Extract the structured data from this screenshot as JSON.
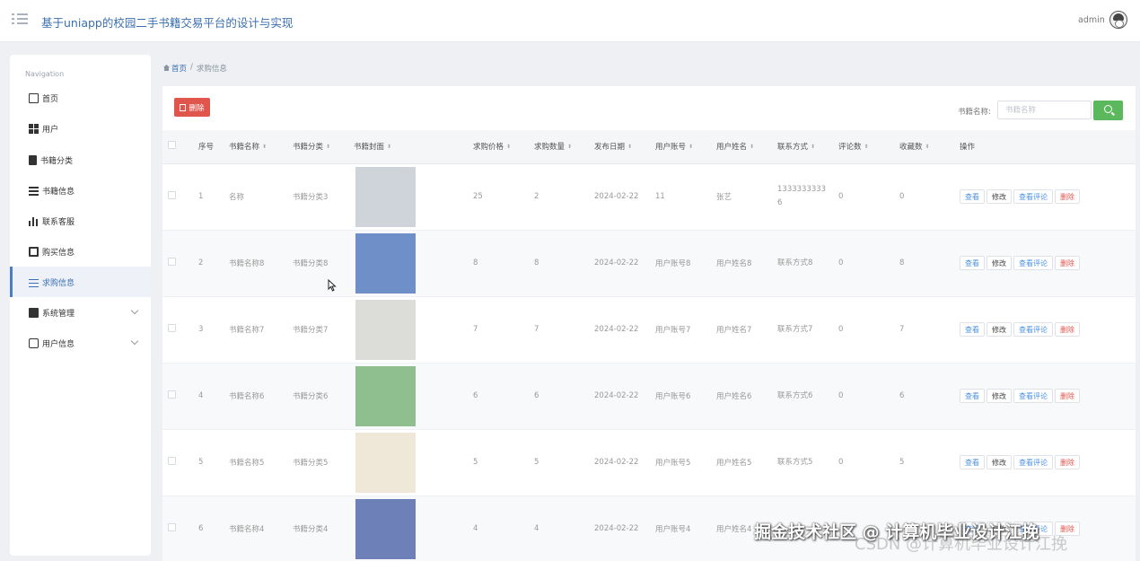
{
  "header": {
    "title": "基于uniapp的校园二手书籍交易平台的设计与实现",
    "user": "admin"
  },
  "sidebar": {
    "heading": "Navigation",
    "items": [
      {
        "label": "首页",
        "icon": "home-icon"
      },
      {
        "label": "用户",
        "icon": "grid-icon"
      },
      {
        "label": "书籍分类",
        "icon": "book-icon"
      },
      {
        "label": "书籍信息",
        "icon": "list-icon"
      },
      {
        "label": "联系客服",
        "icon": "bar-chart-icon"
      },
      {
        "label": "购买信息",
        "icon": "cart-icon"
      },
      {
        "label": "求购信息",
        "icon": "sliders-icon",
        "active": true
      },
      {
        "label": "系统管理",
        "icon": "chart-icon",
        "expandable": true
      },
      {
        "label": "用户信息",
        "icon": "card-icon",
        "expandable": true
      }
    ]
  },
  "breadcrumb": {
    "home": "首页",
    "separator": "/",
    "current": "求购信息"
  },
  "toolbar": {
    "delete_label": "删除",
    "search_label": "书籍名称:",
    "search_placeholder": "书籍名称"
  },
  "table": {
    "headers": [
      "序号",
      "书籍名称",
      "书籍分类",
      "书籍封面",
      "求购价格",
      "求购数量",
      "发布日期",
      "用户账号",
      "用户姓名",
      "联系方式",
      "评论数",
      "收藏数",
      "操作"
    ],
    "actions": {
      "view": "查看",
      "edit": "修改",
      "comments": "查看评论",
      "delete": "删除"
    },
    "rows": [
      {
        "no": "1",
        "name": "名称",
        "category": "书籍分类3",
        "price": "25",
        "qty": "2",
        "date": "2024-02-22",
        "account": "11",
        "username": "张艺",
        "contact": "13333333336",
        "comments": "0",
        "favorites": "0",
        "cover": "#cfd3da"
      },
      {
        "no": "2",
        "name": "书籍名称8",
        "category": "书籍分类8",
        "price": "8",
        "qty": "8",
        "date": "2024-02-22",
        "account": "用户账号8",
        "username": "用户姓名8",
        "contact": "联系方式8",
        "comments": "0",
        "favorites": "8",
        "cover": "#6f8fc9"
      },
      {
        "no": "3",
        "name": "书籍名称7",
        "category": "书籍分类7",
        "price": "7",
        "qty": "7",
        "date": "2024-02-22",
        "account": "用户账号7",
        "username": "用户姓名7",
        "contact": "联系方式7",
        "comments": "0",
        "favorites": "7",
        "cover": "#dcdcd8"
      },
      {
        "no": "4",
        "name": "书籍名称6",
        "category": "书籍分类6",
        "price": "6",
        "qty": "6",
        "date": "2024-02-22",
        "account": "用户账号6",
        "username": "用户姓名6",
        "contact": "联系方式6",
        "comments": "0",
        "favorites": "6",
        "cover": "#8fbf8f"
      },
      {
        "no": "5",
        "name": "书籍名称5",
        "category": "书籍分类5",
        "price": "5",
        "qty": "5",
        "date": "2024-02-22",
        "account": "用户账号5",
        "username": "用户姓名5",
        "contact": "联系方式5",
        "comments": "0",
        "favorites": "5",
        "cover": "#efe8d8"
      },
      {
        "no": "6",
        "name": "书籍名称4",
        "category": "书籍分类4",
        "price": "4",
        "qty": "4",
        "date": "2024-02-22",
        "account": "用户账号4",
        "username": "用户姓名4",
        "contact": "",
        "comments": "",
        "favorites": "",
        "cover": "#6d80b8"
      }
    ]
  },
  "watermark": {
    "main": "掘金技术社区 @ 计算机毕业设计江挽",
    "ghost": "CSDN @计算机毕业设计江挽"
  }
}
